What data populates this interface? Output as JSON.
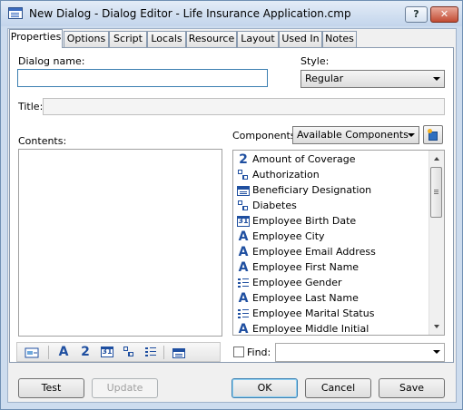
{
  "window": {
    "title": "New Dialog - Dialog Editor - Life Insurance Application.cmp",
    "help_label": "?",
    "close_label": "✕"
  },
  "tabs": [
    {
      "label": "Properties",
      "active": true
    },
    {
      "label": "Options"
    },
    {
      "label": "Script"
    },
    {
      "label": "Locals"
    },
    {
      "label": "Resource"
    },
    {
      "label": "Layout"
    },
    {
      "label": "Used In"
    },
    {
      "label": "Notes"
    }
  ],
  "form": {
    "dialog_name_label": "Dialog name:",
    "dialog_name_value": "",
    "style_label": "Style:",
    "style_value": "Regular",
    "title_label": "Title:",
    "title_value": "",
    "contents_label": "Contents:",
    "components_label": "Components:",
    "components_filter": "Available Components",
    "find_label": "Find:",
    "find_value": ""
  },
  "components": [
    {
      "icon": "number-icon",
      "glyph": "2",
      "label": "Amount of Coverage"
    },
    {
      "icon": "tree-icon",
      "glyph": "",
      "label": "Authorization"
    },
    {
      "icon": "table-icon",
      "glyph": "",
      "label": "Beneficiary Designation"
    },
    {
      "icon": "tree-icon",
      "glyph": "",
      "label": "Diabetes"
    },
    {
      "icon": "date-icon",
      "glyph": "31",
      "label": "Employee Birth Date"
    },
    {
      "icon": "text-icon",
      "glyph": "A",
      "label": "Employee City"
    },
    {
      "icon": "text-icon",
      "glyph": "A",
      "label": "Employee Email Address"
    },
    {
      "icon": "text-icon",
      "glyph": "A",
      "label": "Employee First Name"
    },
    {
      "icon": "list-icon",
      "glyph": "",
      "label": "Employee Gender"
    },
    {
      "icon": "text-icon",
      "glyph": "A",
      "label": "Employee Last Name"
    },
    {
      "icon": "list-icon",
      "glyph": "",
      "label": "Employee Marital Status"
    },
    {
      "icon": "text-icon",
      "glyph": "A",
      "label": "Employee Middle Initial"
    }
  ],
  "toolbar_glyphs": {
    "text": "A",
    "number": "2",
    "date": "31"
  },
  "buttons": {
    "test": "Test",
    "update": "Update",
    "ok": "OK",
    "cancel": "Cancel",
    "save": "Save"
  },
  "colors": {
    "accent": "#1f4fa0",
    "title_bar": "#c3d5ec",
    "close": "#c24c33"
  }
}
